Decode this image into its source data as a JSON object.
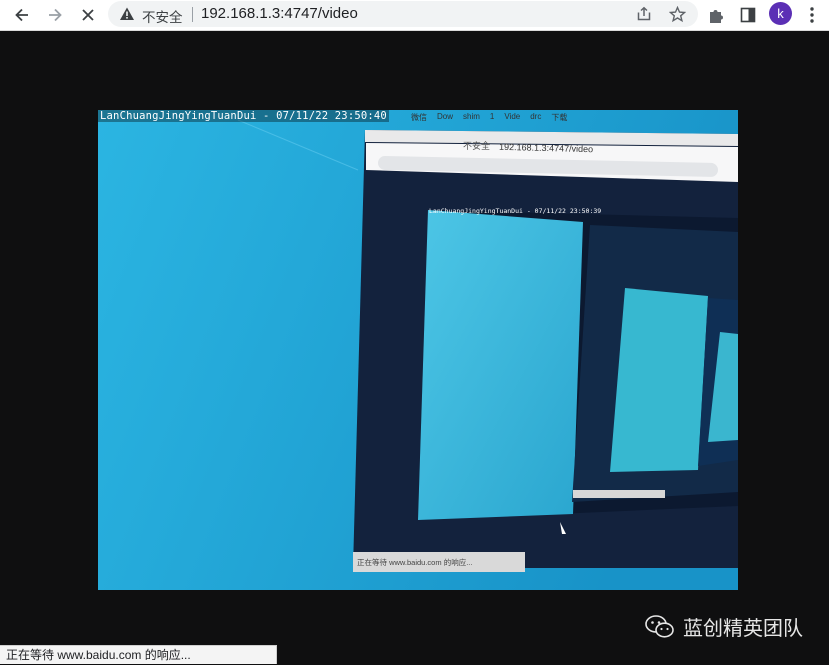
{
  "browser": {
    "security_label": "不安全",
    "url": "192.168.1.3:4747/video",
    "profile_initial": "k"
  },
  "video": {
    "overlay_text": "LanChuangJingYingTuanDui - 07/11/22 23:50:40",
    "inner_tabs": [
      "微信",
      "Dow",
      "shim",
      "1",
      "Vide",
      "drc",
      "下载"
    ],
    "inner_security_label": "不安全",
    "inner_url": "192.168.1.3:4747/video",
    "inner_overlay_text": "LanChuangJingYingTuanDui - 07/11/22 23:50:39",
    "inner_status": "正在等待 www.baidu.com 的响应..."
  },
  "status_bar": {
    "text": "正在等待 www.baidu.com 的响应..."
  },
  "watermark": {
    "text": "蓝创精英团队"
  },
  "colors": {
    "avatar": "#5b2fb5",
    "page_bg": "#0f0f10",
    "desktop_blue": "#1da6d9"
  }
}
